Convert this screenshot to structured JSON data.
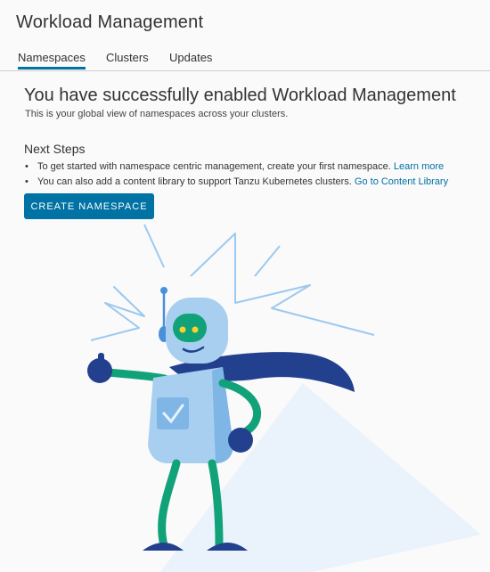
{
  "header": {
    "title": "Workload Management"
  },
  "tabs": [
    {
      "label": "Namespaces",
      "active": true
    },
    {
      "label": "Clusters",
      "active": false
    },
    {
      "label": "Updates",
      "active": false
    }
  ],
  "main": {
    "headline": "You have successfully enabled Workload Management",
    "subline": "This is your global view of namespaces across your clusters.",
    "next_steps_title": "Next Steps",
    "steps": [
      {
        "text": "To get started with namespace centric management, create your first namespace.",
        "link": "Learn more"
      },
      {
        "text": "You can also add a content library to support Tanzu Kubernetes clusters.",
        "link": "Go to Content Library"
      }
    ],
    "create_button": "CREATE NAMESPACE"
  },
  "illustration": {
    "icon": "robot-with-cape-illustration"
  },
  "colors": {
    "accent": "#0072a3",
    "robot_body": "#a8cff0",
    "robot_dark": "#23408e",
    "arms_legs": "#12a27a"
  }
}
